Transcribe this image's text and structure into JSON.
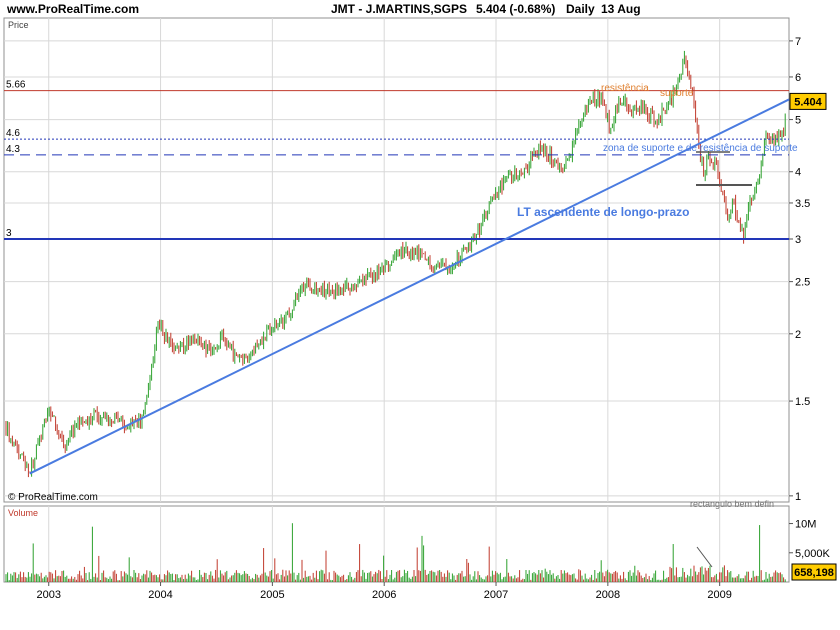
{
  "header": {
    "site": "www.ProRealTime.com",
    "title": "JMT - J.MARTINS,SGPS",
    "change": "5.404 (-0.68%)",
    "period": "Daily",
    "date": "13 Aug"
  },
  "colors": {
    "background": "#ffffff",
    "grid": "#d8d8d8",
    "up": "#2ca02c",
    "down": "#c0392b",
    "trendline": "#4a7be0",
    "support_line": "#2236b8",
    "resistance_line": "#c0392b",
    "price_badge": "#ffcc00",
    "annotation_orange": "#e08030",
    "annotation_blue": "#4a7be0"
  },
  "chart_data": [
    {
      "type": "candlestick",
      "panel_label": "Price",
      "scale": "log",
      "ylim": [
        1,
        7.8
      ],
      "yticks": [
        1,
        1.5,
        2,
        2.5,
        3,
        3.5,
        4,
        5,
        6,
        7
      ],
      "xlim": [
        2002.6,
        2009.62
      ],
      "xticks": [
        "2003",
        "2004",
        "2005",
        "2006",
        "2007",
        "2008",
        "2009"
      ],
      "last_price": "5.404",
      "watermark": "© ProRealTime.com",
      "series_path": [
        [
          2002.6,
          1.35
        ],
        [
          2002.72,
          1.22
        ],
        [
          2002.83,
          1.1
        ],
        [
          2002.92,
          1.28
        ],
        [
          2003.0,
          1.45
        ],
        [
          2003.08,
          1.32
        ],
        [
          2003.15,
          1.22
        ],
        [
          2003.25,
          1.36
        ],
        [
          2003.4,
          1.4
        ],
        [
          2003.6,
          1.38
        ],
        [
          2003.75,
          1.35
        ],
        [
          2003.83,
          1.4
        ],
        [
          2003.9,
          1.58
        ],
        [
          2003.97,
          2.1
        ],
        [
          2004.05,
          1.95
        ],
        [
          2004.15,
          1.85
        ],
        [
          2004.3,
          1.98
        ],
        [
          2004.45,
          1.85
        ],
        [
          2004.55,
          1.95
        ],
        [
          2004.7,
          1.78
        ],
        [
          2004.85,
          1.9
        ],
        [
          2005.0,
          2.05
        ],
        [
          2005.1,
          2.1
        ],
        [
          2005.2,
          2.3
        ],
        [
          2005.3,
          2.5
        ],
        [
          2005.4,
          2.42
        ],
        [
          2005.6,
          2.4
        ],
        [
          2005.8,
          2.5
        ],
        [
          2006.0,
          2.62
        ],
        [
          2006.15,
          2.85
        ],
        [
          2006.3,
          2.8
        ],
        [
          2006.45,
          2.68
        ],
        [
          2006.6,
          2.7
        ],
        [
          2006.72,
          2.85
        ],
        [
          2006.85,
          3.15
        ],
        [
          2007.0,
          3.65
        ],
        [
          2007.1,
          3.9
        ],
        [
          2007.25,
          4.05
        ],
        [
          2007.38,
          4.4
        ],
        [
          2007.5,
          4.25
        ],
        [
          2007.6,
          4.0
        ],
        [
          2007.66,
          4.3
        ],
        [
          2007.75,
          4.95
        ],
        [
          2007.85,
          5.45
        ],
        [
          2007.95,
          5.5
        ],
        [
          2008.02,
          4.8
        ],
        [
          2008.1,
          5.5
        ],
        [
          2008.2,
          5.2
        ],
        [
          2008.3,
          5.25
        ],
        [
          2008.45,
          5.0
        ],
        [
          2008.55,
          5.4
        ],
        [
          2008.62,
          5.75
        ],
        [
          2008.68,
          6.5
        ],
        [
          2008.73,
          5.9
        ],
        [
          2008.78,
          5.2
        ],
        [
          2008.82,
          4.3
        ],
        [
          2008.86,
          3.95
        ],
        [
          2008.9,
          4.3
        ],
        [
          2008.97,
          4.15
        ],
        [
          2009.02,
          3.7
        ],
        [
          2009.07,
          3.25
        ],
        [
          2009.12,
          3.6
        ],
        [
          2009.18,
          3.1
        ],
        [
          2009.22,
          3.05
        ],
        [
          2009.28,
          3.55
        ],
        [
          2009.35,
          3.9
        ],
        [
          2009.42,
          4.75
        ],
        [
          2009.5,
          4.6
        ],
        [
          2009.56,
          4.7
        ],
        [
          2009.62,
          5.404
        ]
      ],
      "lines": [
        {
          "label": "5.66",
          "value": 5.66,
          "style": "solid",
          "color": "#c0392b"
        },
        {
          "label": "4.6",
          "value": 4.6,
          "style": "dotted",
          "color": "#2236b8"
        },
        {
          "label": "4.3",
          "value": 4.3,
          "style": "dashed",
          "color": "#2236b8"
        },
        {
          "label": "3",
          "value": 3.0,
          "style": "solid-thick",
          "color": "#2236b8"
        }
      ],
      "trendline": {
        "from": [
          2002.83,
          1.1
        ],
        "to": [
          2009.62,
          5.45
        ]
      },
      "annotations": [
        {
          "text": "LT ascendente de longo-prazo",
          "color": "#4a7be0"
        },
        {
          "text": "resistência",
          "color": "#e08030"
        },
        {
          "text": "suporte",
          "color": "#e08030"
        },
        {
          "text": "zona de suporte e de resistência de suporte",
          "color": "#4a7be0"
        },
        {
          "text": "rectangulo bem defin",
          "color": "#777777"
        }
      ]
    },
    {
      "type": "bar",
      "panel_label": "Volume",
      "yticks": [
        "10M",
        "5,000K"
      ],
      "ylim": [
        0,
        13000000
      ],
      "last_value": "658,198"
    }
  ]
}
